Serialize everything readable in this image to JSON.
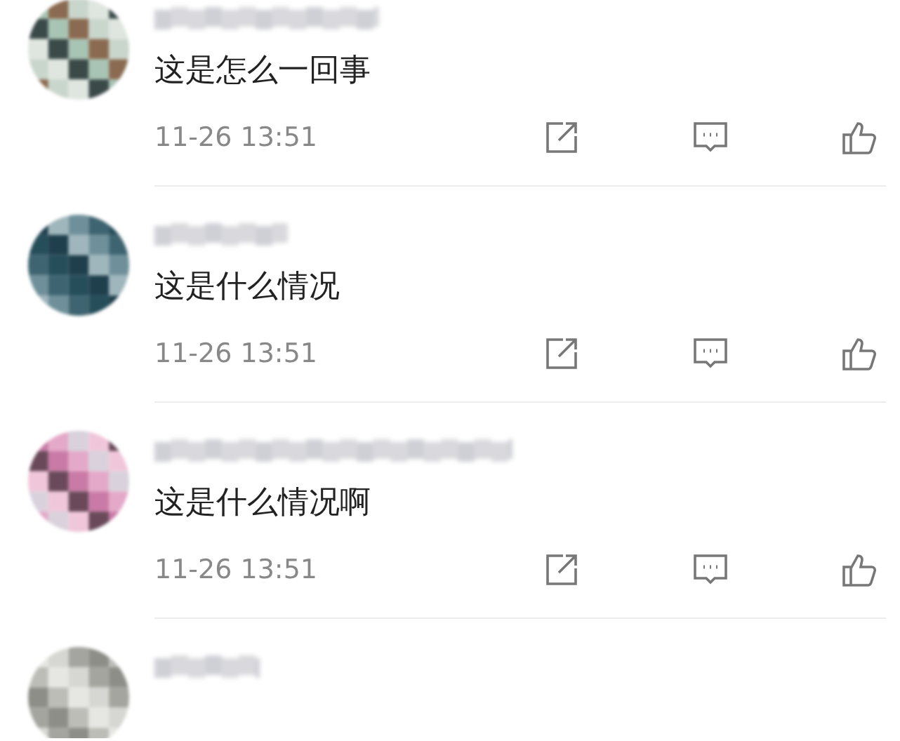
{
  "comments": [
    {
      "kind": "full",
      "text": "这是怎么一回事",
      "time": "11-26 13:51"
    },
    {
      "kind": "full",
      "text": "这是什么情况",
      "time": "11-26 13:51"
    },
    {
      "kind": "full",
      "text": "这是什么情况啊",
      "time": "11-26 13:51"
    },
    {
      "kind": "cut"
    }
  ]
}
